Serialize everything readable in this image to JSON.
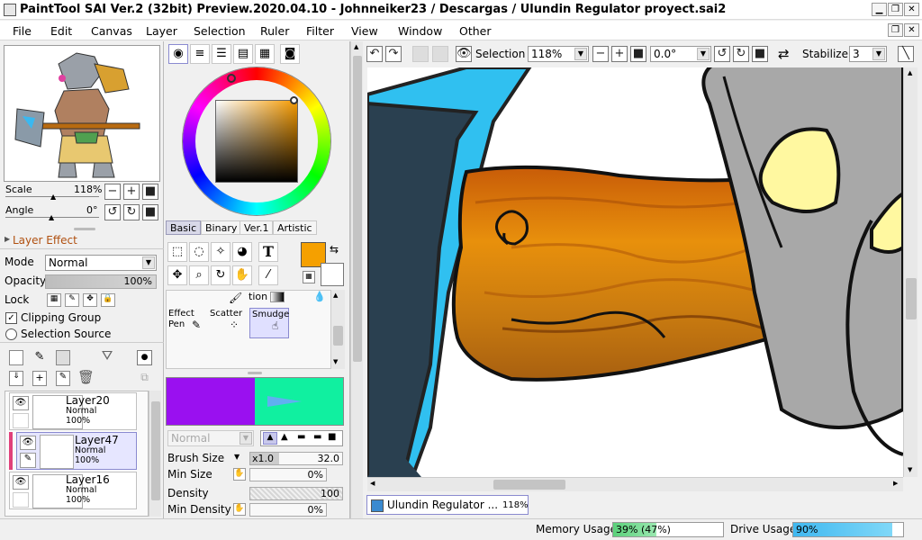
{
  "title": "PaintTool SAI Ver.2 (32bit) Preview.2020.04.10 - Johnneiker23 / Descargas / Ulundin Regulator proyect.sai2",
  "menu": [
    "File",
    "Edit",
    "Canvas",
    "Layer",
    "Selection",
    "Ruler",
    "Filter",
    "View",
    "Window",
    "Other"
  ],
  "navigator": {
    "scale_label": "Scale",
    "scale_value": "118%",
    "angle_label": "Angle",
    "angle_value": "0°"
  },
  "layer_effect": {
    "title": "Layer Effect",
    "mode_label": "Mode",
    "mode_value": "Normal",
    "opacity_label": "Opacity",
    "opacity_value": "100%",
    "lock_label": "Lock",
    "clipping_group": "Clipping Group",
    "selection_source": "Selection Source"
  },
  "layers": [
    {
      "name": "Layer20",
      "mode": "Normal",
      "opacity": "100%",
      "selected": false
    },
    {
      "name": "Layer47",
      "mode": "Normal",
      "opacity": "100%",
      "selected": true
    },
    {
      "name": "Layer16",
      "mode": "Normal",
      "opacity": "100%",
      "selected": false
    }
  ],
  "color_panel": {
    "tabs": [
      "Basic",
      "Binary",
      "Ver.1",
      "Artistic"
    ],
    "selected_tab": "Basic",
    "primary_color": "#f5a000",
    "secondary_color": "#ffffff"
  },
  "brush_tools": {
    "partial_label": "tion",
    "items": [
      {
        "label1": "Effect",
        "label2": "Pen"
      },
      {
        "label1": "Scatter",
        "label2": ""
      },
      {
        "label1": "Smudge",
        "label2": ""
      }
    ],
    "selected": "Smudge"
  },
  "brush_settings": {
    "blend_mode": "Normal",
    "brush_size_label": "Brush Size",
    "brush_size_mult": "x1.0",
    "brush_size_value": "32.0",
    "min_size_label": "Min Size",
    "min_size_value": "0%",
    "density_label": "Density",
    "density_value": "100",
    "min_density_label": "Min Density",
    "min_density_value": "0%"
  },
  "canvas_toolbar": {
    "selection_label": "Selection",
    "zoom_value": "118%",
    "rotation_value": "0.0°",
    "stabilizer_label": "Stabilizer",
    "stabilizer_value": "3"
  },
  "document_tab": {
    "name": "Ulundin Regulator ...",
    "zoom": "118%"
  },
  "status": {
    "memory_label": "Memory Usage",
    "memory_value": "39% (47%)",
    "memory_fraction": 0.39,
    "drive_label": "Drive Usage",
    "drive_value": "90%",
    "drive_fraction": 0.9
  },
  "colors": {
    "accent_cyan": "#3ab8f0",
    "wood_orange": "#d07808",
    "memory_green": "#6cd88a",
    "drive_blue": "#5cc4f0"
  }
}
